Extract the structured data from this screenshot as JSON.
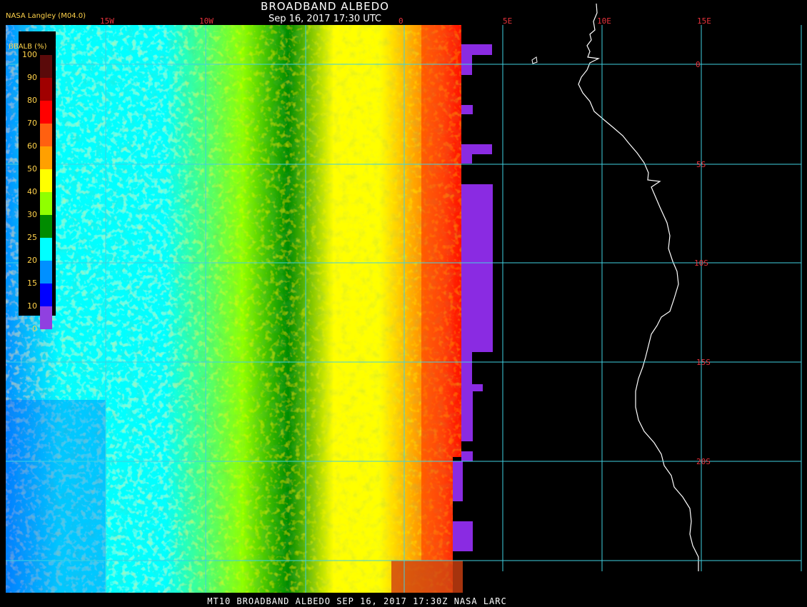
{
  "header": {
    "title": "BROADBAND ALBEDO",
    "subtitle": "Sep 16, 2017 17:30 UTC",
    "provider": "NASA Langley (M04.0)"
  },
  "legend": {
    "title": "BBALB (%)",
    "ticks": [
      "100",
      "90",
      "80",
      "70",
      "60",
      "50",
      "40",
      "30",
      "25",
      "20",
      "15",
      "10",
      "0"
    ],
    "colors": [
      "#5a0a0a",
      "#a00000",
      "#ff0000",
      "#ff6010",
      "#ffa000",
      "#ffff00",
      "#90ff00",
      "#008c00",
      "#00ffff",
      "#0090ff",
      "#0000ff",
      "#9040e0"
    ]
  },
  "map": {
    "lon_labels": [
      "15W",
      "10W",
      "0",
      "5E",
      "10E",
      "15E"
    ],
    "lat_labels": [
      "0",
      "5S",
      "10S",
      "15S",
      "20S"
    ],
    "grid_color": "#40d0e0",
    "label_color": "#e8323c",
    "coast_color": "#ffffff"
  },
  "footer": {
    "text": "MT10  BROADBAND ALBEDO   SEP 16, 2017 17:30Z   NASA LARC"
  }
}
